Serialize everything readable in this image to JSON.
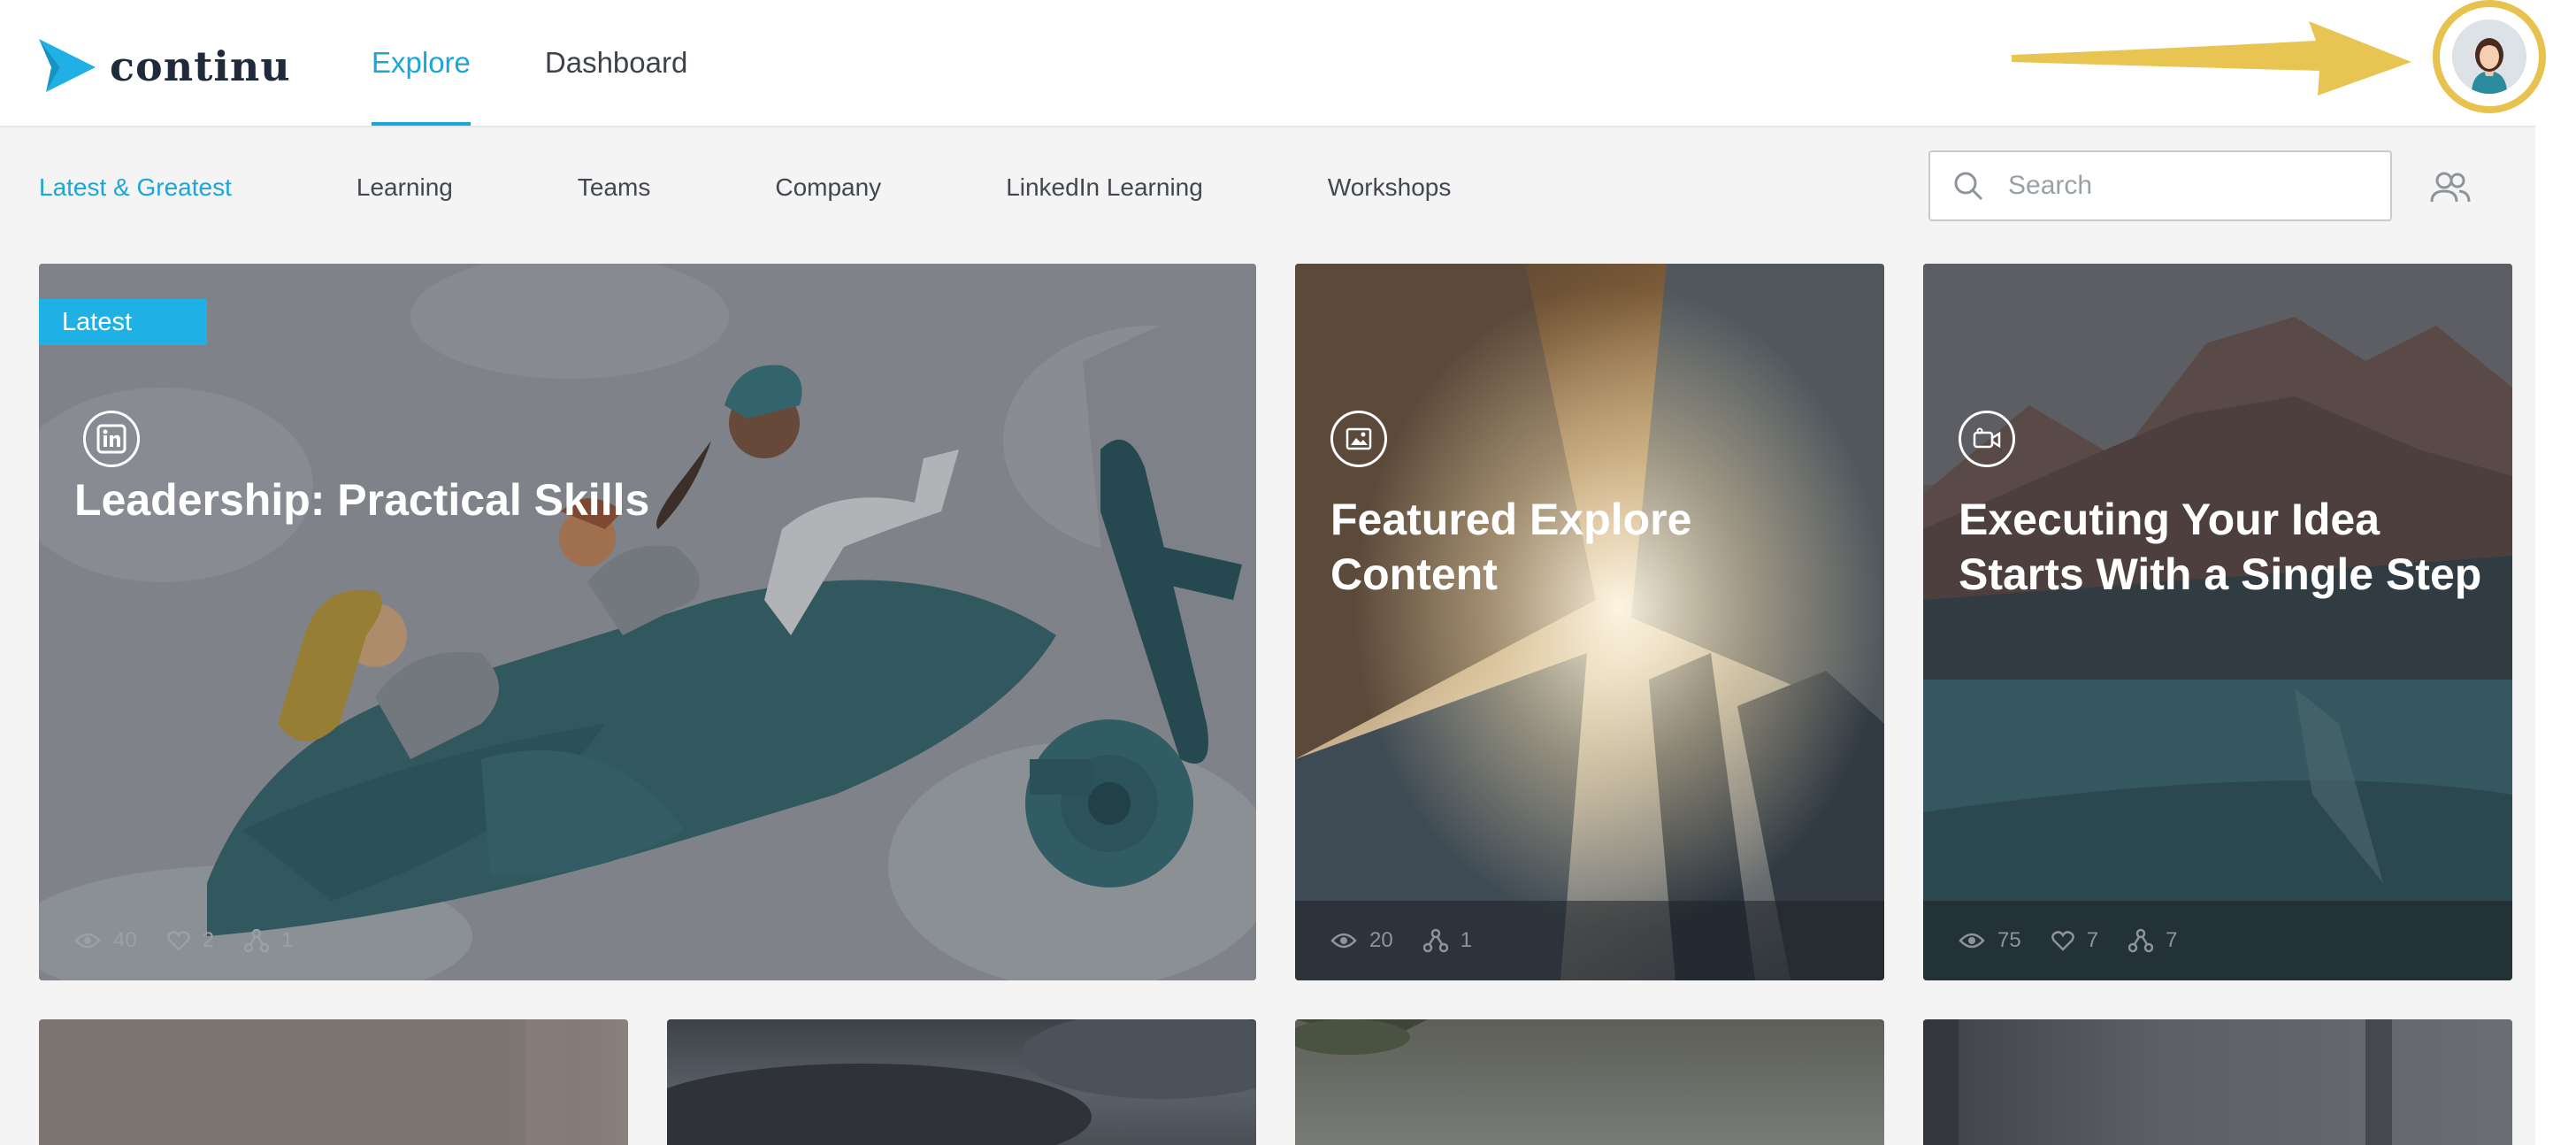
{
  "app": {
    "logo_text": "continu",
    "accent_color": "#1aa6d8",
    "highlight_color": "#e7c24e"
  },
  "header": {
    "tabs": [
      {
        "label": "Explore",
        "active": true
      },
      {
        "label": "Dashboard",
        "active": false
      }
    ],
    "avatar_icon": "user-avatar-icon"
  },
  "subnav": {
    "items": [
      {
        "label": "Latest & Greatest",
        "active": true
      },
      {
        "label": "Learning",
        "active": false
      },
      {
        "label": "Teams",
        "active": false
      },
      {
        "label": "Company",
        "active": false
      },
      {
        "label": "LinkedIn Learning",
        "active": false
      },
      {
        "label": "Workshops",
        "active": false
      }
    ],
    "search": {
      "placeholder": "Search",
      "value": ""
    },
    "people_icon": "people-icon"
  },
  "cards": [
    {
      "badge": "Latest",
      "icon": "linkedin-icon",
      "title": "Leadership: Practical Skills",
      "stats": {
        "views": "40",
        "likes": "2",
        "shares": "1"
      }
    },
    {
      "icon": "image-icon",
      "title_line1": "Featured Explore",
      "title_line2": "Content",
      "stats": {
        "views": "20",
        "shares": "1"
      }
    },
    {
      "icon": "video-icon",
      "title_line1": "Executing Your Idea",
      "title_line2": "Starts With a Single Step",
      "stats": {
        "views": "75",
        "likes": "7",
        "shares": "7"
      }
    }
  ]
}
